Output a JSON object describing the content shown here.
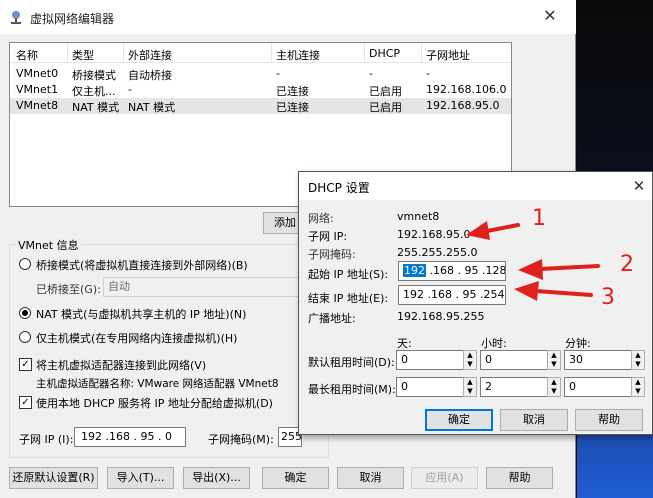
{
  "main_window": {
    "title": "虚拟网络编辑器",
    "table": {
      "columns": [
        "名称",
        "类型",
        "外部连接",
        "主机连接",
        "DHCP",
        "子网地址"
      ],
      "rows": [
        [
          "VMnet0",
          "桥接模式",
          "自动桥接",
          "-",
          "-",
          "-"
        ],
        [
          "VMnet1",
          "仅主机...",
          "-",
          "已连接",
          "已启用",
          "192.168.106.0"
        ],
        [
          "VMnet8",
          "NAT 模式",
          "NAT 模式",
          "已连接",
          "已启用",
          "192.168.95.0"
        ]
      ]
    },
    "add_network_label": "添加",
    "vmnet_info": "VMnet 信息",
    "bridge_mode": "桥接模式(将虚拟机直接连接到外部网络)(B)",
    "bridged_to": "已桥接至(G):",
    "bridged_to_value": "自动",
    "nat_mode": "NAT 模式(与虚拟机共享主机的 IP 地址)(N)",
    "host_only_mode": "仅主机模式(在专用网络内连接虚拟机)(H)",
    "connect_adapter": "将主机虚拟适配器连接到此网络(V)",
    "adapter_name": "主机虚拟适配器名称: VMware 网络适配器 VMnet8",
    "use_dhcp": "使用本地 DHCP 服务将 IP 地址分配给虚拟机(D)",
    "subnet_ip_label": "子网 IP (I):",
    "subnet_ip_value": "192 .168 . 95 . 0",
    "subnet_mask_label": "子网掩码(M):",
    "subnet_mask_value": "255",
    "buttons": {
      "restore": "还原默认设置(R)",
      "import": "导入(T)...",
      "export": "导出(X)...",
      "ok": "确定",
      "cancel": "取消",
      "apply": "应用(A)",
      "help": "帮助"
    }
  },
  "dhcp_dialog": {
    "title": "DHCP 设置",
    "network_label": "网络:",
    "network_value": "vmnet8",
    "subnet_ip_label": "子网 IP:",
    "subnet_ip_value": "192.168.95.0",
    "subnet_mask_label": "子网掩码:",
    "subnet_mask_value": "255.255.255.0",
    "start_ip_label": "起始 IP 地址(S):",
    "start_ip_value": "192 .168 . 95 .128",
    "start_ip_selected": "192",
    "end_ip_label": "结束 IP 地址(E):",
    "end_ip_value": "192 .168 . 95 .254",
    "broadcast_label": "广播地址:",
    "broadcast_value": "192.168.95.255",
    "col_days": "天:",
    "col_hours": "小时:",
    "col_minutes": "分钟:",
    "default_lease_label": "默认租用时间(D):",
    "default_lease": [
      "0",
      "0",
      "30"
    ],
    "max_lease_label": "最长租用时间(M):",
    "max_lease": [
      "0",
      "2",
      "0"
    ],
    "ok": "确定",
    "cancel": "取消",
    "help": "帮助"
  },
  "annotations": {
    "n1": "1",
    "n2": "2",
    "n3": "3",
    "arrow_color": "#e0201c"
  }
}
